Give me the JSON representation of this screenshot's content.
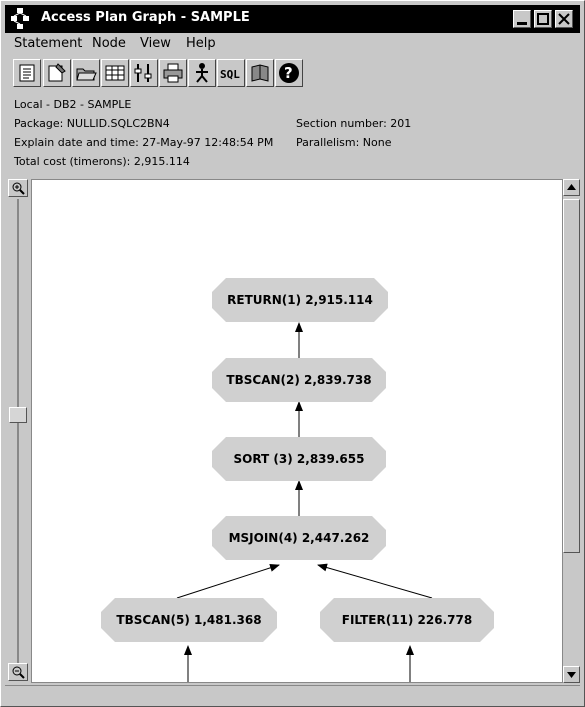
{
  "window": {
    "title": "Access Plan Graph - SAMPLE"
  },
  "menu": {
    "statement": "Statement",
    "node": "Node",
    "view": "View",
    "help": "Help"
  },
  "toolbar": {
    "icons": [
      "view-details-icon",
      "notepad-icon",
      "open-folder-icon",
      "table-icon",
      "statistics-icon",
      "print-icon",
      "usage-icon",
      "sql-icon",
      "book-icon",
      "help-icon"
    ],
    "sql_label": "SQL"
  },
  "info": {
    "location": "Local - DB2 - SAMPLE",
    "package": "Package: NULLID.SQLC2BN4",
    "explain_date": "Explain date and time: 27-May-97 12:48:54 PM",
    "total_cost": "Total cost (timerons): 2,915.114",
    "section_number": "Section number: 201",
    "parallelism": "Parallelism: None"
  },
  "graph": {
    "nodes": [
      {
        "id": "return",
        "label": "RETURN(1) 2,915.114"
      },
      {
        "id": "tbscan2",
        "label": "TBSCAN(2) 2,839.738"
      },
      {
        "id": "sort3",
        "label": "SORT (3) 2,839.655"
      },
      {
        "id": "msjoin4",
        "label": "MSJOIN(4) 2,447.262"
      },
      {
        "id": "tbscan5",
        "label": "TBSCAN(5) 1,481.368"
      },
      {
        "id": "filter11",
        "label": "FILTER(11) 226.778"
      }
    ]
  },
  "colors": {
    "node_fill": "#d0d0d0",
    "titlebar": "#000000",
    "window_bg": "#c8c8c8"
  }
}
